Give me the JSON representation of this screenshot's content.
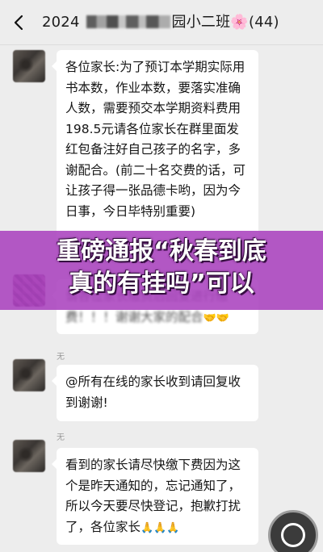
{
  "chat": {
    "title_prefix": "2024",
    "title_suffix": "园小二班",
    "title_emoji": "🌸",
    "member_count": "(44)"
  },
  "banner": {
    "line1": "重磅通报“秋春到底",
    "line2": "真的有挂吗”可以"
  },
  "messages": [
    {
      "sender": "",
      "text": "各位家长:为了预订本学期实际用书本数，作业本数，要落实准确人数，需要预交本学期资料费用 198.5元请各位家长在群里面发红包备注好自己孩子的名字，多谢配合。(前二十名交费的话，可让孩子得一张品德卡哟，因为今日事，今日毕特别重要)"
    },
    {
      "sender": "",
      "text": "请各位家长缴费后回复进行缴费！！！谢谢大家的配合",
      "emoji": "🤝🤝"
    },
    {
      "sender": "无",
      "text": "@所有在线的家长收到请回复收到谢谢!"
    },
    {
      "sender": "无",
      "text": "看到的家长请尽快缴下费因为这个是昨天通知的，忘记通知了，所以今天要尽快登记，抱歉打扰了，各位家长",
      "emoji": "🙏🙏🙏"
    }
  ],
  "icons": {
    "back": "chevron-left-icon",
    "scroll": "scroll-to-bottom-icon"
  }
}
